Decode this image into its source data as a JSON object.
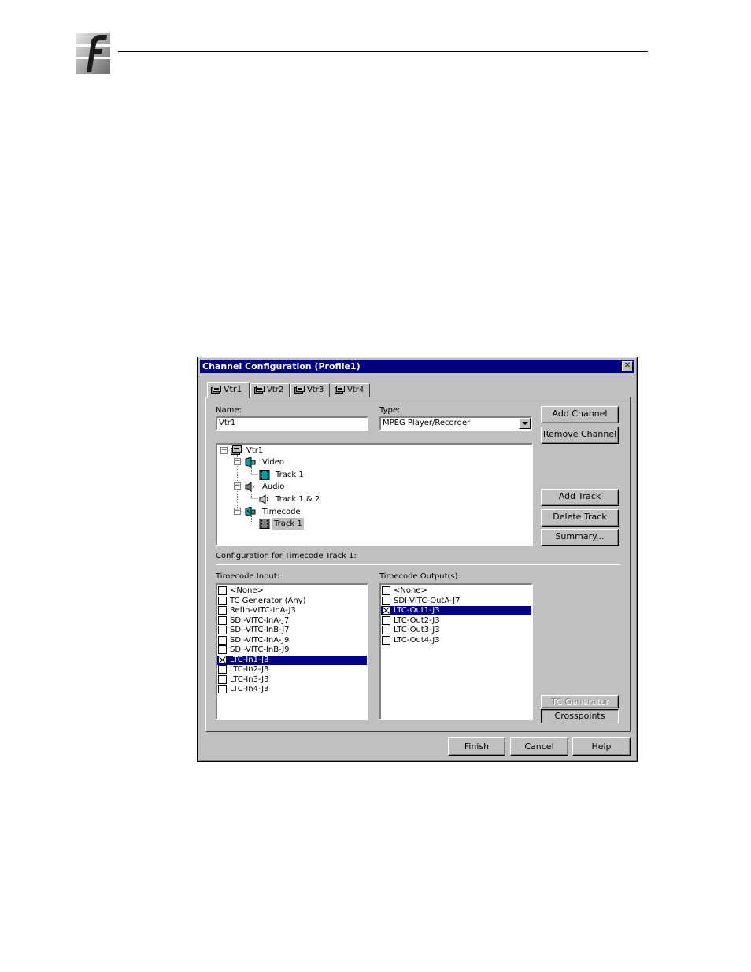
{
  "dialog": {
    "title": "Channel Configuration (Profile1)",
    "close_glyph": "✕"
  },
  "tabs": [
    {
      "label": "Vtr1",
      "active": true
    },
    {
      "label": "Vtr2"
    },
    {
      "label": "Vtr3"
    },
    {
      "label": "Vtr4"
    }
  ],
  "form": {
    "name_label": "Name:",
    "name_value": "Vtr1",
    "type_label": "Type:",
    "type_value": "MPEG Player/Recorder"
  },
  "buttons": {
    "add_channel": "Add Channel",
    "remove_channel": "Remove Channel",
    "add_track": "Add Track",
    "delete_track": "Delete Track",
    "summary": "Summary...",
    "tc_generator": "TC Generator",
    "crosspoints": "Crosspoints",
    "finish": "Finish",
    "cancel": "Cancel",
    "help": "Help"
  },
  "tree": {
    "root": "Vtr1",
    "video": "Video",
    "video_track": "Track 1",
    "audio": "Audio",
    "audio_track": "Track 1 & 2",
    "timecode": "Timecode",
    "timecode_track": "Track 1",
    "expander_glyph": "−"
  },
  "config_label": "Configuration for Timecode Track 1:",
  "timecode_input": {
    "label": "Timecode Input:",
    "items": [
      {
        "text": "<None>",
        "checked": false
      },
      {
        "text": "TC Generator (Any)",
        "checked": false
      },
      {
        "text": "RefIn-VITC-InA-J3",
        "checked": false
      },
      {
        "text": "SDI-VITC-InA-J7",
        "checked": false
      },
      {
        "text": "SDI-VITC-InB-J7",
        "checked": false
      },
      {
        "text": "SDI-VITC-InA-J9",
        "checked": false
      },
      {
        "text": "SDI-VITC-InB-J9",
        "checked": false
      },
      {
        "text": "LTC-In1-J3",
        "checked": true,
        "selected": true
      },
      {
        "text": "LTC-In2-J3",
        "checked": false
      },
      {
        "text": "LTC-In3-J3",
        "checked": false
      },
      {
        "text": "LTC-In4-J3",
        "checked": false
      }
    ]
  },
  "timecode_output": {
    "label": "Timecode Output(s):",
    "items": [
      {
        "text": "<None>",
        "checked": false
      },
      {
        "text": "SDI-VITC-OutA-J7",
        "checked": false
      },
      {
        "text": "LTC-Out1-J3",
        "checked": true,
        "selected": true
      },
      {
        "text": "LTC-Out2-J3",
        "checked": false
      },
      {
        "text": "LTC-Out3-J3",
        "checked": false
      },
      {
        "text": "LTC-Out4-J3",
        "checked": false
      }
    ]
  },
  "colors": {
    "titlebar": "#000080",
    "face": "#c0c0c0",
    "selection": "#000080"
  }
}
